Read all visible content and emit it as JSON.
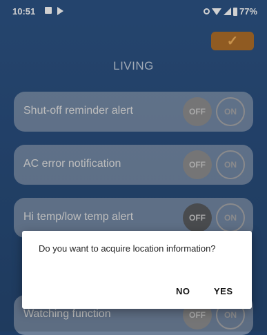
{
  "status_bar": {
    "time": "10:51",
    "battery": "77%"
  },
  "header": {
    "confirm_icon": "checkmark-icon",
    "confirm_glyph": "✓",
    "title": "LIVING"
  },
  "settings": [
    {
      "label": "Shut-off reminder alert",
      "off_label": "OFF",
      "on_label": "ON"
    },
    {
      "label": "AC error notification",
      "off_label": "OFF",
      "on_label": "ON"
    },
    {
      "label": "Hi temp/low temp alert",
      "off_label": "OFF",
      "on_label": "ON"
    },
    {
      "label": "Watching function",
      "off_label": "OFF",
      "on_label": "ON"
    }
  ],
  "dialog": {
    "message": "Do you want to acquire location information?",
    "no_label": "NO",
    "yes_label": "YES"
  },
  "colors": {
    "background": "#2a4f7f",
    "accent": "#b0702a"
  }
}
